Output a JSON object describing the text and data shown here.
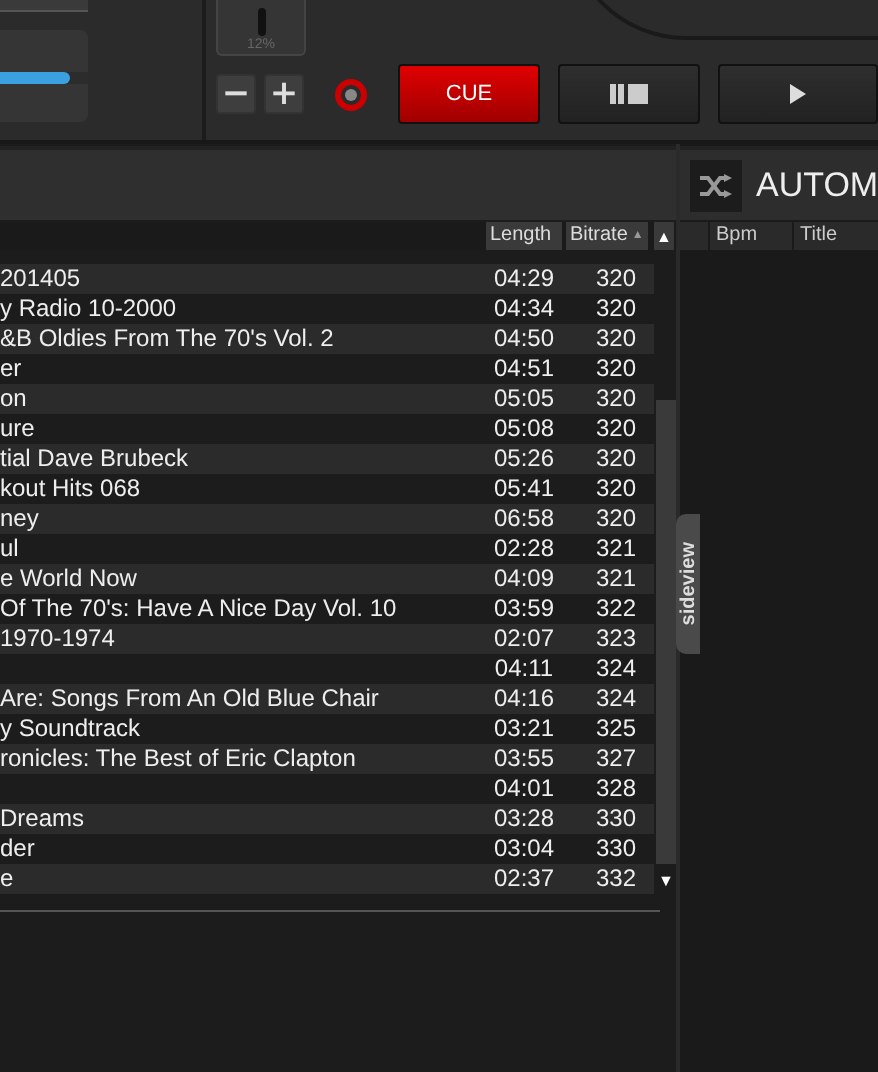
{
  "deck": {
    "pitch_reading": "12%",
    "slider": {
      "level": 0.8
    },
    "buttons": [
      {
        "label": "−"
      },
      {
        "label": "+"
      }
    ],
    "transport": [
      {
        "kind": "cue",
        "label": "CUE"
      },
      {
        "kind": "pause"
      },
      {
        "kind": "play"
      }
    ]
  },
  "browser": {
    "columns": [
      {
        "label": "Length"
      },
      {
        "label": "Bitrate",
        "sort_arrow": "▲"
      }
    ],
    "scroll_up": "▲",
    "scroll_down": "▼",
    "rows": [
      {
        "title": "201405",
        "length": "04:29",
        "bitrate": "320"
      },
      {
        "title": "y Radio 10-2000",
        "length": "04:34",
        "bitrate": "320"
      },
      {
        "title": "&B Oldies From The 70's Vol. 2",
        "length": "04:50",
        "bitrate": "320"
      },
      {
        "title": "er",
        "length": "04:51",
        "bitrate": "320"
      },
      {
        "title": "on",
        "length": "05:05",
        "bitrate": "320"
      },
      {
        "title": "ure",
        "length": "05:08",
        "bitrate": "320"
      },
      {
        "title": "tial Dave Brubeck",
        "length": "05:26",
        "bitrate": "320"
      },
      {
        "title": "kout Hits 068",
        "length": "05:41",
        "bitrate": "320"
      },
      {
        "title": "ney",
        "length": "06:58",
        "bitrate": "320"
      },
      {
        "title": "ul",
        "length": "02:28",
        "bitrate": "321"
      },
      {
        "title": "e World Now",
        "length": "04:09",
        "bitrate": "321"
      },
      {
        "title": "Of The 70's: Have A Nice Day Vol. 10",
        "length": "03:59",
        "bitrate": "322"
      },
      {
        "title": "1970-1974",
        "length": "02:07",
        "bitrate": "323"
      },
      {
        "length": "04:11",
        "bitrate": "324"
      },
      {
        "title": "Are: Songs From An Old Blue Chair",
        "length": "04:16",
        "bitrate": "324"
      },
      {
        "title": "y Soundtrack",
        "length": "03:21",
        "bitrate": "325"
      },
      {
        "title": "ronicles: The Best of Eric Clapton",
        "length": "03:55",
        "bitrate": "327"
      },
      {
        "length": "04:01",
        "bitrate": "328"
      },
      {
        "title": "Dreams",
        "length": "03:28",
        "bitrate": "330"
      },
      {
        "title": "der",
        "length": "03:04",
        "bitrate": "330"
      },
      {
        "title": "e",
        "length": "02:37",
        "bitrate": "332"
      }
    ],
    "sideview_tab": "sideview"
  },
  "automix": {
    "title": "AUTOM",
    "columns": [
      {
        "label": "Bpm"
      },
      {
        "label": "Title"
      }
    ]
  }
}
